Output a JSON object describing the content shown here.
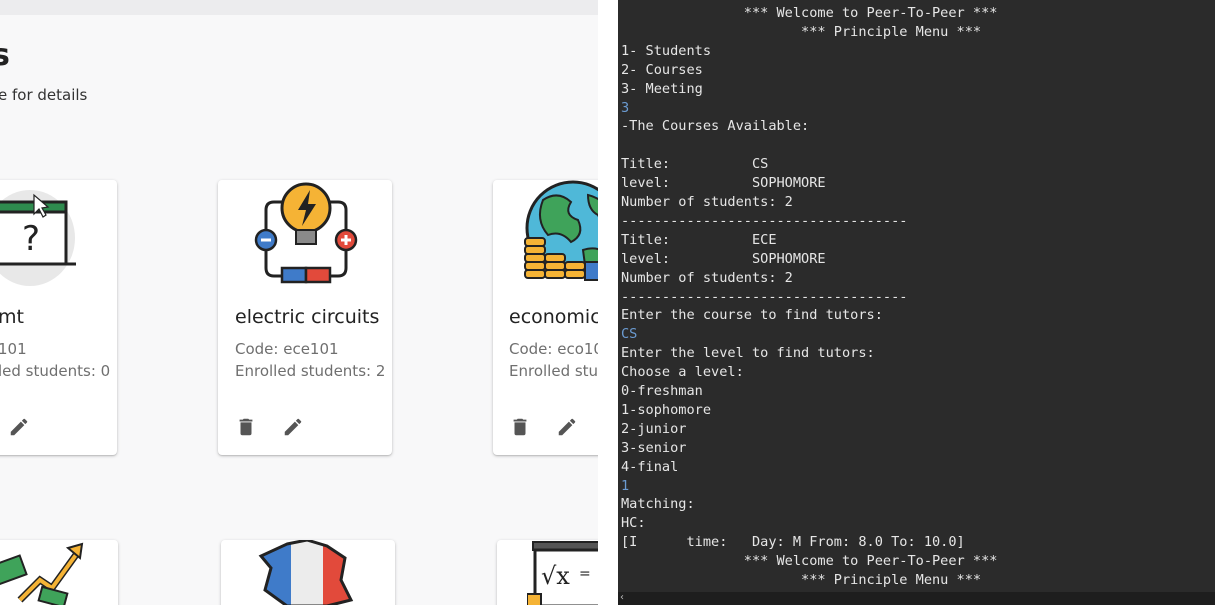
{
  "web": {
    "heading": "s",
    "subtitle": "e for details",
    "cards": [
      {
        "name": "mt",
        "code": " 101",
        "enrolled": "led students: 0"
      },
      {
        "name": "electric circuits",
        "code": "Code: ece101",
        "enrolled": "Enrolled students: 2"
      },
      {
        "name": "economic",
        "code": "Code: eco10",
        "enrolled": "Enrolled stud"
      }
    ],
    "icons": [
      "question-laptop-icon",
      "lightbulb-circuit-icon",
      "globe-coins-icon",
      "money-growth-icon",
      "france-map-icon",
      "math-board-icon",
      "delete-icon",
      "edit-icon"
    ]
  },
  "terminal": {
    "lines": [
      {
        "text": "               *** Welcome to Peer-To-Peer ***",
        "input": false
      },
      {
        "text": "                      *** Principle Menu ***",
        "input": false
      },
      {
        "text": "1- Students",
        "input": false
      },
      {
        "text": "2- Courses",
        "input": false
      },
      {
        "text": "3- Meeting",
        "input": false
      },
      {
        "text": "3",
        "input": true
      },
      {
        "text": "-The Courses Available:",
        "input": false
      },
      {
        "text": "",
        "input": false
      },
      {
        "text": "Title:          CS",
        "input": false
      },
      {
        "text": "level:          SOPHOMORE",
        "input": false
      },
      {
        "text": "Number of students: 2",
        "input": false
      },
      {
        "text": "-----------------------------------",
        "input": false
      },
      {
        "text": "Title:          ECE",
        "input": false
      },
      {
        "text": "level:          SOPHOMORE",
        "input": false
      },
      {
        "text": "Number of students: 2",
        "input": false
      },
      {
        "text": "-----------------------------------",
        "input": false
      },
      {
        "text": "Enter the course to find tutors:",
        "input": false
      },
      {
        "text": "CS",
        "input": true
      },
      {
        "text": "Enter the level to find tutors:",
        "input": false
      },
      {
        "text": "Choose a level:",
        "input": false
      },
      {
        "text": "0-freshman",
        "input": false
      },
      {
        "text": "1-sophomore",
        "input": false
      },
      {
        "text": "2-junior",
        "input": false
      },
      {
        "text": "3-senior",
        "input": false
      },
      {
        "text": "4-final",
        "input": false
      },
      {
        "text": "1",
        "input": true
      },
      {
        "text": "Matching:",
        "input": false
      },
      {
        "text": "HC:",
        "input": false
      },
      {
        "text": "[I      time:   Day: M From: 8.0 To: 10.0]",
        "input": false
      },
      {
        "text": "               *** Welcome to Peer-To-Peer ***",
        "input": false
      },
      {
        "text": "                      *** Principle Menu ***",
        "input": false
      }
    ],
    "scroll_left_glyph": "‹"
  }
}
